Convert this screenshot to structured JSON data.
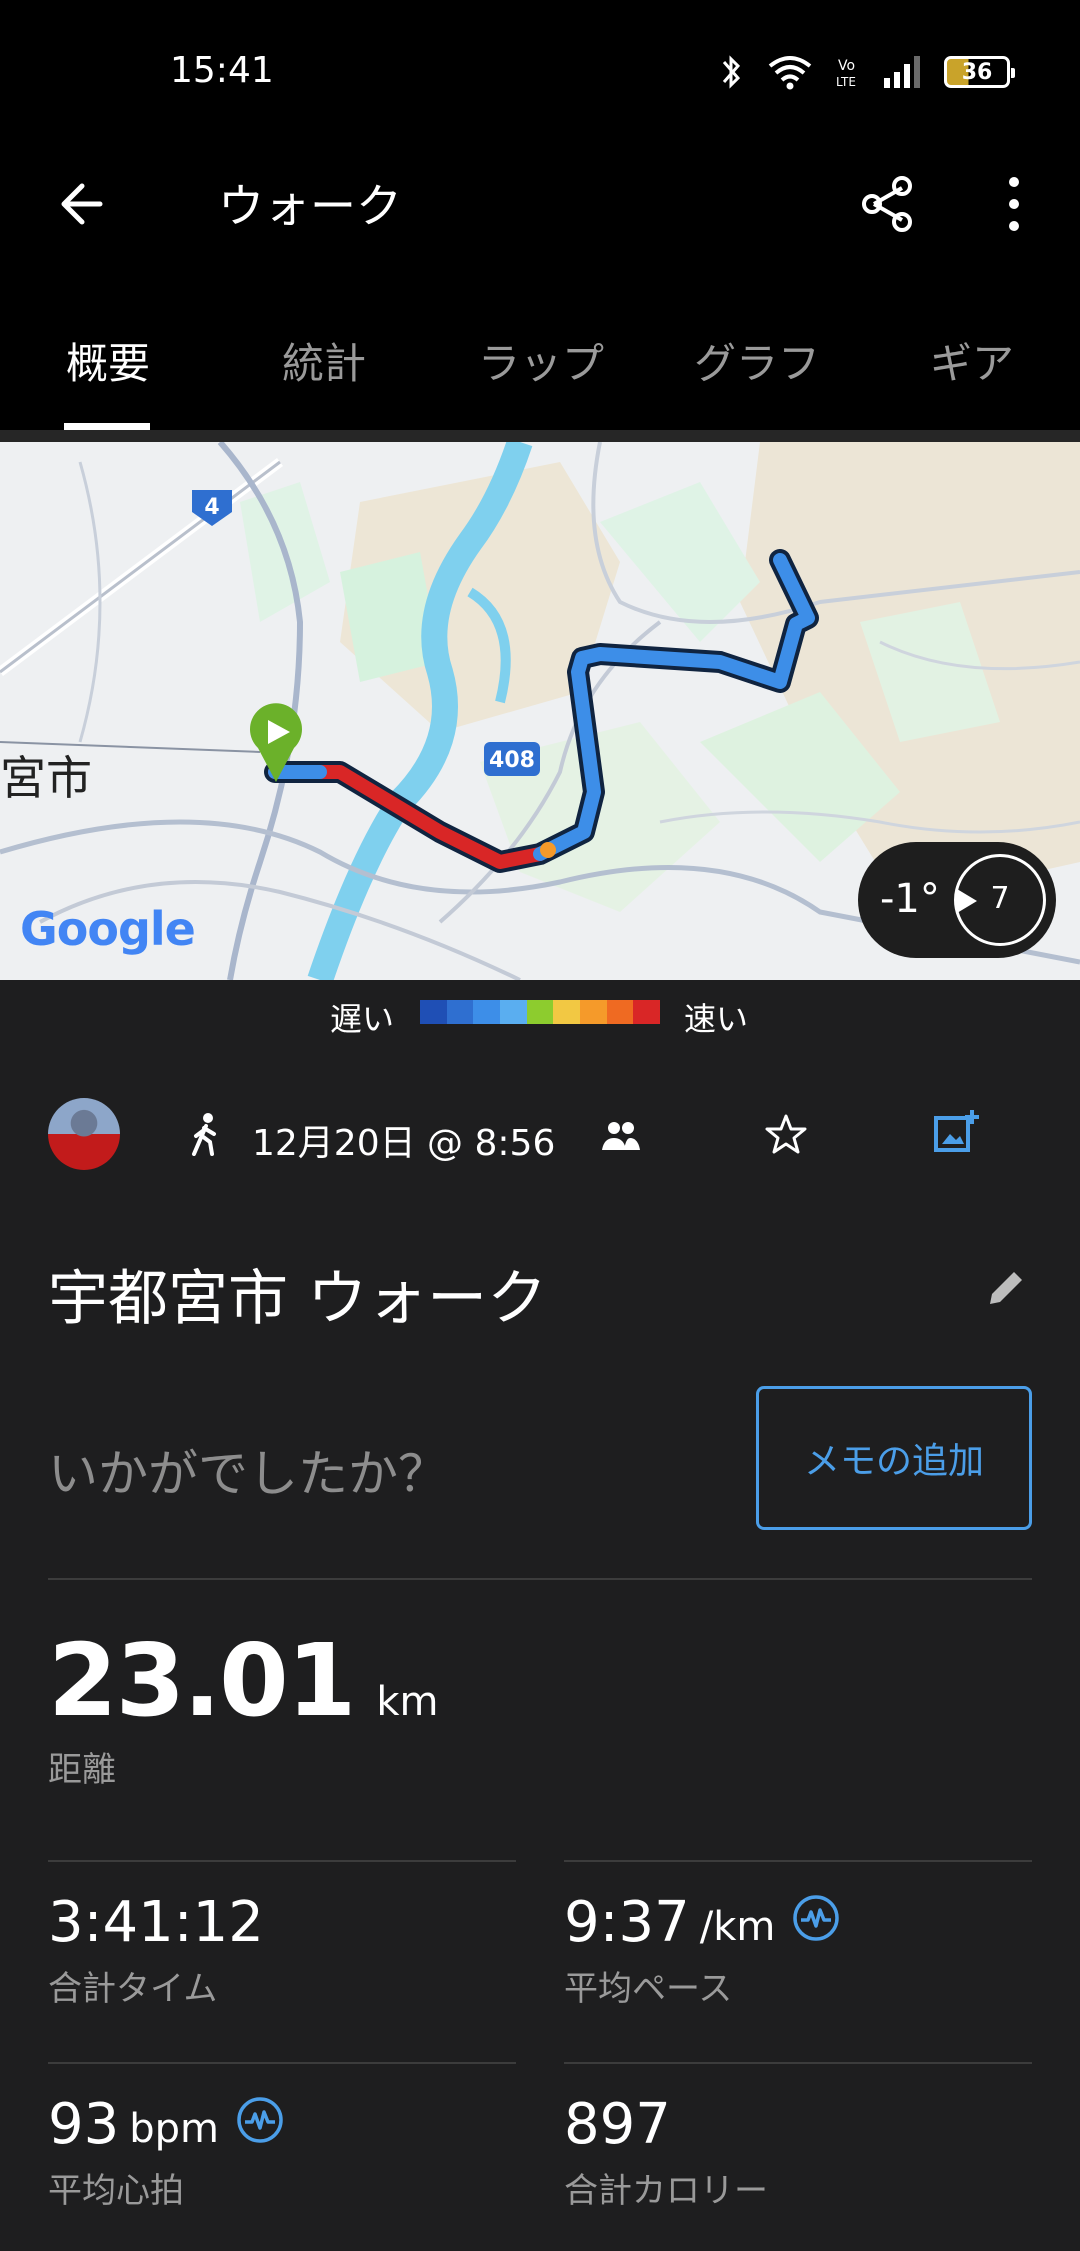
{
  "status_bar": {
    "time": "15:41",
    "battery": "36"
  },
  "app_bar": {
    "title": "ウォーク"
  },
  "tabs": [
    {
      "label": "概要"
    },
    {
      "label": "統計"
    },
    {
      "label": "ラップ"
    },
    {
      "label": "グラフ"
    },
    {
      "label": "ギア"
    }
  ],
  "map": {
    "city_label": "宮市",
    "road_4": "4",
    "road_408": "408",
    "google_logo": "Google",
    "weather": {
      "temperature": "-1°",
      "wind": "7"
    }
  },
  "speed_legend": {
    "slow": "遅い",
    "fast": "速い",
    "colors": [
      "#1f4fb5",
      "#2f6fd0",
      "#3d8ee8",
      "#5aaef0",
      "#8dcc2e",
      "#f2c843",
      "#f59a2a",
      "#ef6a22",
      "#d92626"
    ]
  },
  "activity": {
    "date": "12月20日 @ 8:56",
    "name": "宇都宮市 ウォーク",
    "memo_prompt": "いかがでしたか？",
    "memo_button": "メモの追加"
  },
  "stats": {
    "distance": {
      "value": "23.01",
      "unit": "km",
      "label": "距離"
    },
    "total_time": {
      "value": "3:41:12",
      "label": "合計タイム"
    },
    "avg_pace": {
      "value": "9:37",
      "unit": "/km",
      "label": "平均ペース"
    },
    "avg_hr": {
      "value": "93",
      "unit": "bpm",
      "label": "平均心拍"
    },
    "calories": {
      "value": "897",
      "label": "合計カロリー"
    }
  },
  "colors": {
    "accent": "#4b9ee8",
    "background": "#1e1e1f"
  }
}
